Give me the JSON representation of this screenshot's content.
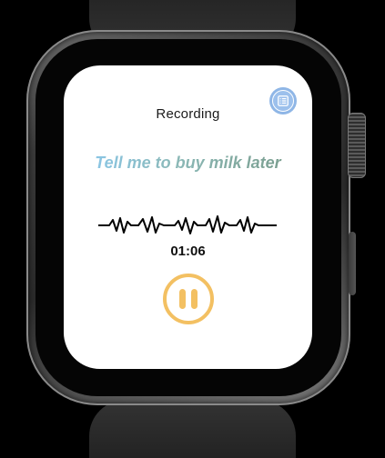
{
  "screen": {
    "title": "Recording",
    "phrase": "Tell me to buy milk later",
    "timer": "01:06"
  },
  "controls": {
    "list_icon": "list-icon",
    "pause_icon": "pause-icon"
  },
  "colors": {
    "accent_pause": "#f3c062",
    "list_button": "#8fb6e6",
    "phrase_gradient_start": "#8ac6e6",
    "phrase_gradient_end": "#7a9e8f",
    "screen_background": "#ffffff"
  }
}
